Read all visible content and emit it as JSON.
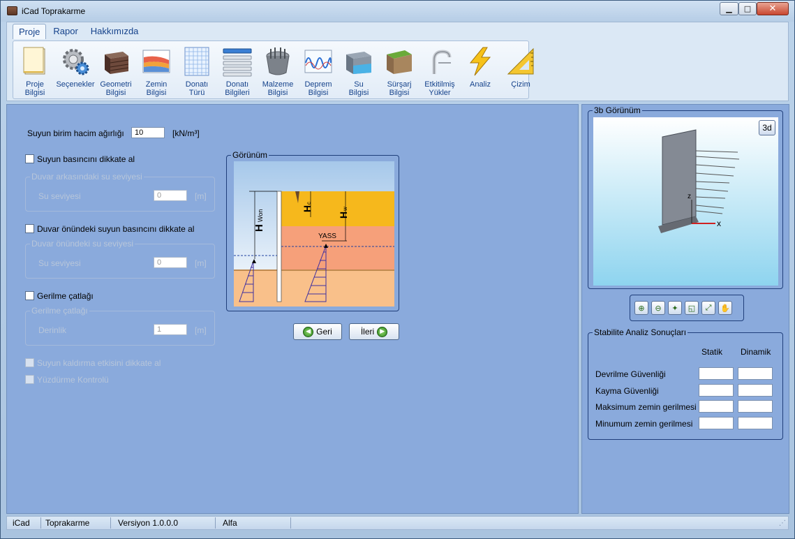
{
  "window": {
    "title": "iCad Toprakarme"
  },
  "tabs": [
    {
      "label": "Proje"
    },
    {
      "label": "Rapor"
    },
    {
      "label": "Hakkımızda"
    }
  ],
  "ribbon": [
    {
      "label": "Proje\nBilgisi"
    },
    {
      "label": "Seçenekler"
    },
    {
      "label": "Geometri\nBilgisi"
    },
    {
      "label": "Zemin\nBilgisi"
    },
    {
      "label": "Donatı\nTürü"
    },
    {
      "label": "Donatı\nBilgileri"
    },
    {
      "label": "Malzeme\nBilgisi"
    },
    {
      "label": "Deprem\nBilgisi"
    },
    {
      "label": "Su\nBilgisi"
    },
    {
      "label": "Sürşarj\nBilgisi"
    },
    {
      "label": "Etkitilmiş\nYükler"
    },
    {
      "label": "Analiz"
    },
    {
      "label": "Çizim"
    }
  ],
  "form": {
    "unit_weight_label": "Suyun birim hacim ağırlığı",
    "unit_weight_value": "10",
    "unit_weight_unit": "[kN/m³]",
    "back_water_check": "Suyun basıncını dikkate al",
    "back_water_group": "Duvar arkasındaki su seviyesi",
    "back_water_level_label": "Su seviyesi",
    "back_water_level_value": "0",
    "back_water_level_unit": "[m]",
    "front_water_check": "Duvar önündeki suyun basıncını dikkate al",
    "front_water_group": "Duvar önündeki su seviyesi",
    "front_water_level_label": "Su seviyesi",
    "front_water_level_value": "0",
    "front_water_level_unit": "[m]",
    "crack_check": "Gerilme çatlağı",
    "crack_group": "Gerilme çatlağı",
    "crack_depth_label": "Derinlik",
    "crack_depth_value": "1",
    "crack_depth_unit": "[m]",
    "uplift_check": "Suyun kaldırma etkisini dikkate al",
    "buoyancy_check": "Yüzdürme Kontrolü"
  },
  "preview": {
    "title": "Görünüm",
    "label_hwon": "H",
    "label_hwon_sub": "Won",
    "label_hc": "H",
    "label_hc_sub": "c",
    "label_hw": "H",
    "label_hw_sub": "w",
    "label_yass": "YASS"
  },
  "nav": {
    "back": "Geri",
    "next": "İleri"
  },
  "view3d": {
    "title": "3b Görünüm",
    "mode_button": "3d",
    "axis_z": "z",
    "axis_x": "x"
  },
  "toolbar_icons": [
    "zoom-in-icon",
    "zoom-out-icon",
    "zoom-extents-icon",
    "zoom-window-icon",
    "fit-icon",
    "pan-icon"
  ],
  "stability": {
    "title": "Stabilite Analiz Sonuçları",
    "col_static": "Statik",
    "col_dynamic": "Dinamik",
    "rows": [
      {
        "label": "Devrilme Güvenliği"
      },
      {
        "label": "Kayma Güvenliği"
      },
      {
        "label": "Maksimum zemin gerilmesi"
      },
      {
        "label": "Minumum zemin gerilmesi"
      }
    ]
  },
  "status": {
    "app": "iCad",
    "module": "Toprakarme",
    "version": "Versiyon 1.0.0.0",
    "stage": "Alfa"
  }
}
